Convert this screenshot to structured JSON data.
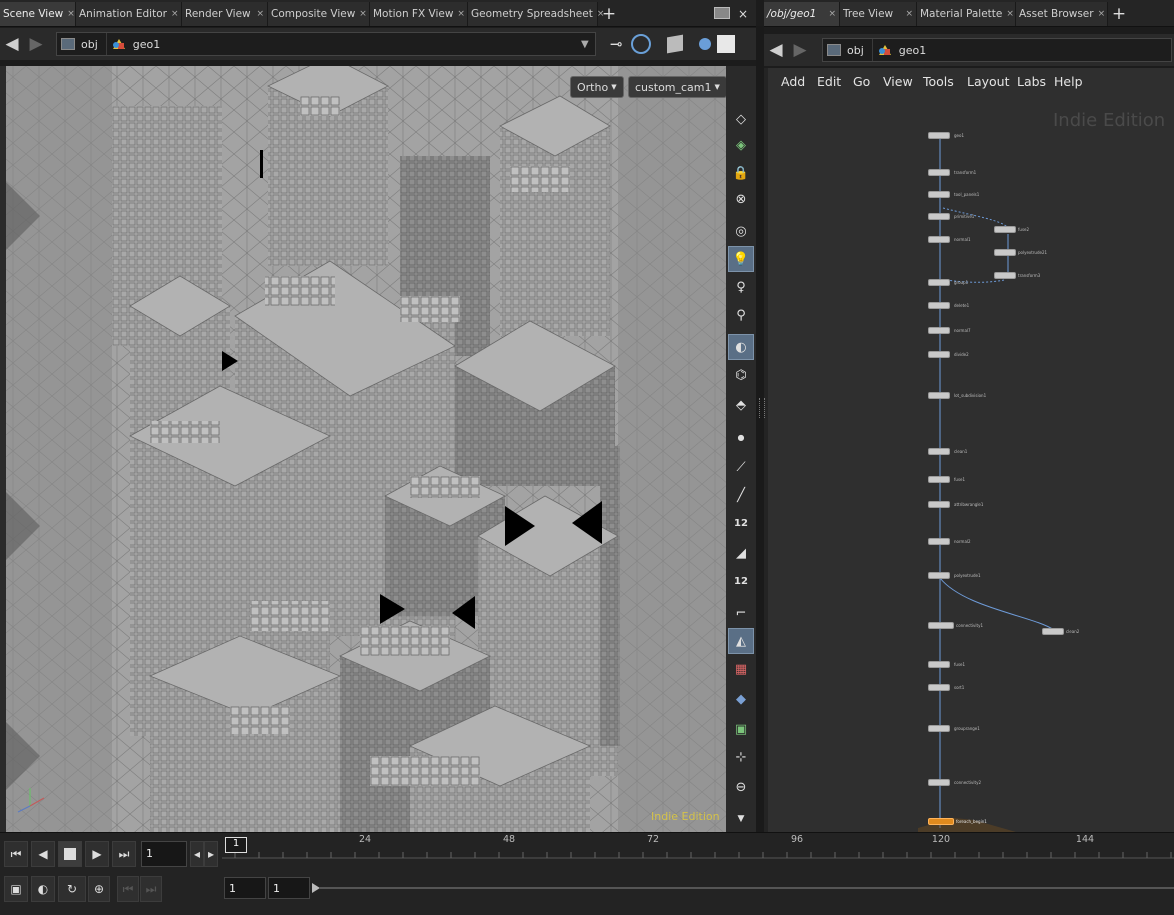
{
  "left_tabs": [
    {
      "label": "Scene View",
      "active": true
    },
    {
      "label": "Animation Editor",
      "active": false
    },
    {
      "label": "Render View",
      "active": false
    },
    {
      "label": "Composite View",
      "active": false
    },
    {
      "label": "Motion FX View",
      "active": false
    },
    {
      "label": "Geometry Spreadsheet",
      "active": false
    }
  ],
  "right_tabs": [
    {
      "label": "/obj/geo1",
      "active": true
    },
    {
      "label": "Tree View",
      "active": false
    },
    {
      "label": "Material Palette",
      "active": false
    },
    {
      "label": "Asset Browser",
      "active": false
    }
  ],
  "tab_close_glyph": "×",
  "plus_glyph": "+",
  "left_path": {
    "level1": "obj",
    "level2": "geo1"
  },
  "right_path": {
    "level1": "obj",
    "level2": "geo1"
  },
  "viewport": {
    "projection": "Ortho",
    "camera": "custom_cam1",
    "watermark": "Indie Edition"
  },
  "network": {
    "menu": [
      "Add",
      "Edit",
      "Go",
      "View",
      "Tools",
      "Layout",
      "Labs",
      "Help"
    ],
    "watermark": "Indie Edition",
    "nodes": [
      {
        "label": "geo1",
        "selected": false
      },
      {
        "label": "transform1",
        "selected": false
      },
      {
        "label": "tool_panels1",
        "selected": false
      },
      {
        "label": "primitive1",
        "selected": false
      },
      {
        "label": "normal1",
        "selected": false
      },
      {
        "label": "fuse2",
        "selected": false
      },
      {
        "label": "polyextrude21",
        "selected": false
      },
      {
        "label": "transform3",
        "selected": false
      },
      {
        "label": "group1",
        "selected": false
      },
      {
        "label": "delete1",
        "selected": false
      },
      {
        "label": "normal7",
        "selected": false
      },
      {
        "label": "divide2",
        "selected": false
      },
      {
        "label": "lot_subdivision1",
        "selected": false
      },
      {
        "label": "clean1",
        "selected": false
      },
      {
        "label": "fuse1",
        "selected": false
      },
      {
        "label": "attribwrangle1",
        "selected": false
      },
      {
        "label": "normal2",
        "selected": false
      },
      {
        "label": "polyextrude1",
        "selected": false
      },
      {
        "label": "connectivity1",
        "selected": false
      },
      {
        "label": "clean2",
        "selected": false
      },
      {
        "label": "fuse1",
        "selected": false
      },
      {
        "label": "sort1",
        "selected": false
      },
      {
        "label": "grouprange1",
        "selected": false
      },
      {
        "label": "connectivity2",
        "selected": false
      },
      {
        "label": "foreach_begin1",
        "selected": true
      }
    ]
  },
  "timeline": {
    "current_frame": "1",
    "frame_marker": "1",
    "ticks": [
      "24",
      "48",
      "72",
      "96",
      "120",
      "144"
    ],
    "range_start": "1",
    "range_end": "1"
  },
  "colors": {
    "accent": "#5a6f86",
    "selected_node": "#e08a1e",
    "watermark": "#d4c24a"
  }
}
